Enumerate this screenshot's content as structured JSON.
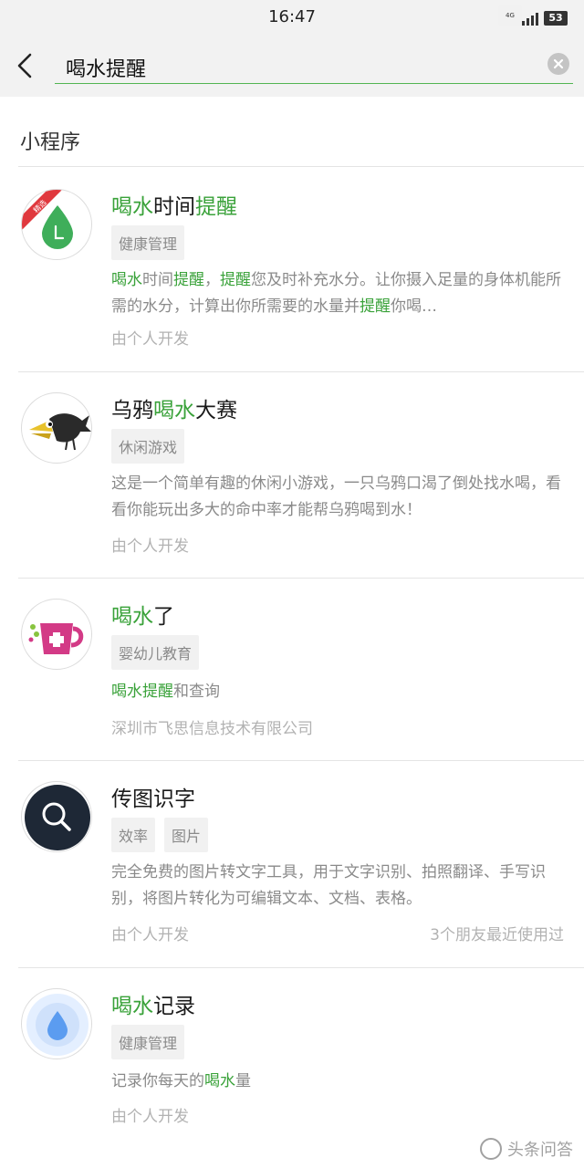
{
  "status_bar": {
    "time": "16:47",
    "network_label": "4G",
    "battery": "53"
  },
  "search": {
    "query": "喝水提醒",
    "back_icon": "back-arrow-icon",
    "clear_icon": "clear-icon"
  },
  "section": {
    "title": "小程序"
  },
  "results": [
    {
      "title_parts": [
        {
          "text": "喝水",
          "hl": true
        },
        {
          "text": "时间",
          "hl": false
        },
        {
          "text": "提醒",
          "hl": true
        }
      ],
      "tags": [
        "健康管理"
      ],
      "desc_parts": [
        {
          "text": "喝水",
          "hl": true
        },
        {
          "text": "时间",
          "hl": false
        },
        {
          "text": "提醒",
          "hl": true
        },
        {
          "text": "，",
          "hl": false
        },
        {
          "text": "提醒",
          "hl": true
        },
        {
          "text": "您及时补充水分。让你摄入足量的身体机能所需的水分，计算出你所需要的水量并",
          "hl": false
        },
        {
          "text": "提醒",
          "hl": true
        },
        {
          "text": "你喝…",
          "hl": false
        }
      ],
      "developer": "由个人开发",
      "icon": "water-drop-clock-icon",
      "ribbon": "精选"
    },
    {
      "title_parts": [
        {
          "text": "乌鸦",
          "hl": false
        },
        {
          "text": "喝水",
          "hl": true
        },
        {
          "text": "大赛",
          "hl": false
        }
      ],
      "tags": [
        "休闲游戏"
      ],
      "desc_parts": [
        {
          "text": "这是一个简单有趣的休闲小游戏，一只乌鸦口渴了倒处找水喝，看看你能玩出多大的命中率才能帮乌鸦喝到水！",
          "hl": false
        }
      ],
      "developer": "由个人开发",
      "icon": "crow-icon"
    },
    {
      "title_parts": [
        {
          "text": "喝水",
          "hl": true
        },
        {
          "text": "了",
          "hl": false
        }
      ],
      "tags": [
        "婴幼儿教育"
      ],
      "desc_parts": [
        {
          "text": "喝水",
          "hl": true
        },
        {
          "text": "提醒",
          "hl": true
        },
        {
          "text": "和查询",
          "hl": false
        }
      ],
      "developer": "深圳市飞思信息技术有限公司",
      "icon": "cup-icon"
    },
    {
      "title_parts": [
        {
          "text": "传图识字",
          "hl": false
        }
      ],
      "tags": [
        "效率",
        "图片"
      ],
      "desc_parts": [
        {
          "text": "完全免费的图片转文字工具，用于文字识别、拍照翻译、手写识别，将图片转化为可编辑文本、文档、表格。",
          "hl": false
        }
      ],
      "developer": "由个人开发",
      "friends": "3个朋友最近使用过",
      "icon": "magnifier-icon"
    },
    {
      "title_parts": [
        {
          "text": "喝水",
          "hl": true
        },
        {
          "text": "记录",
          "hl": false
        }
      ],
      "tags": [
        "健康管理"
      ],
      "desc_parts": [
        {
          "text": "记录你每天的",
          "hl": false
        },
        {
          "text": "喝水",
          "hl": true
        },
        {
          "text": "量",
          "hl": false
        }
      ],
      "developer": "由个人开发",
      "icon": "water-drop-icon"
    }
  ],
  "watermark": "头条问答",
  "colors": {
    "highlight": "#3aa23a",
    "search_underline": "#52b552",
    "secondary_text": "#8a8a8a",
    "tertiary_text": "#b2b2b2",
    "tag_background": "#f1f1f1"
  }
}
